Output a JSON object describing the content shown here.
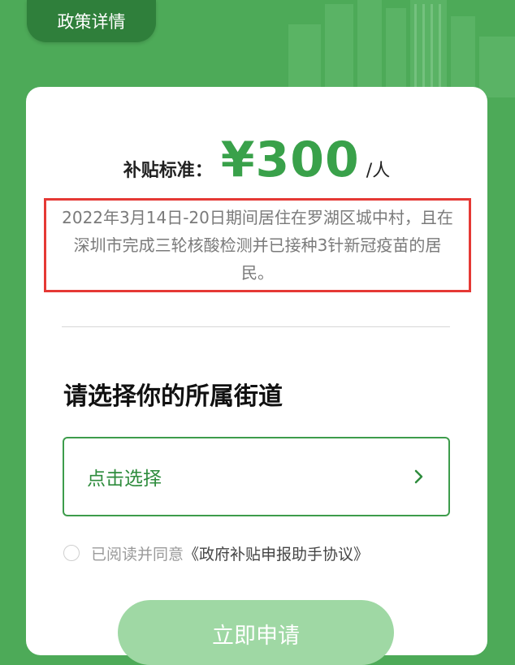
{
  "header": {
    "policy_button_label": "政策详情"
  },
  "subsidy": {
    "label": "补贴标准：",
    "amount": "¥300",
    "unit": "/人"
  },
  "condition_text": "2022年3月14日-20日期间居住在罗湖区城中村，且在深圳市完成三轮核酸检测并已接种3针新冠疫苗的居民。",
  "street": {
    "title": "请选择你的所属街道",
    "select_placeholder": "点击选择"
  },
  "agreement": {
    "prefix": "已阅读并同意",
    "link": "《政府补贴申报助手协议》"
  },
  "apply_button_label": "立即申请",
  "colors": {
    "background": "#4daa58",
    "accent": "#39a14a",
    "highlight_border": "#e53935",
    "button_light": "#9fd8a4"
  }
}
